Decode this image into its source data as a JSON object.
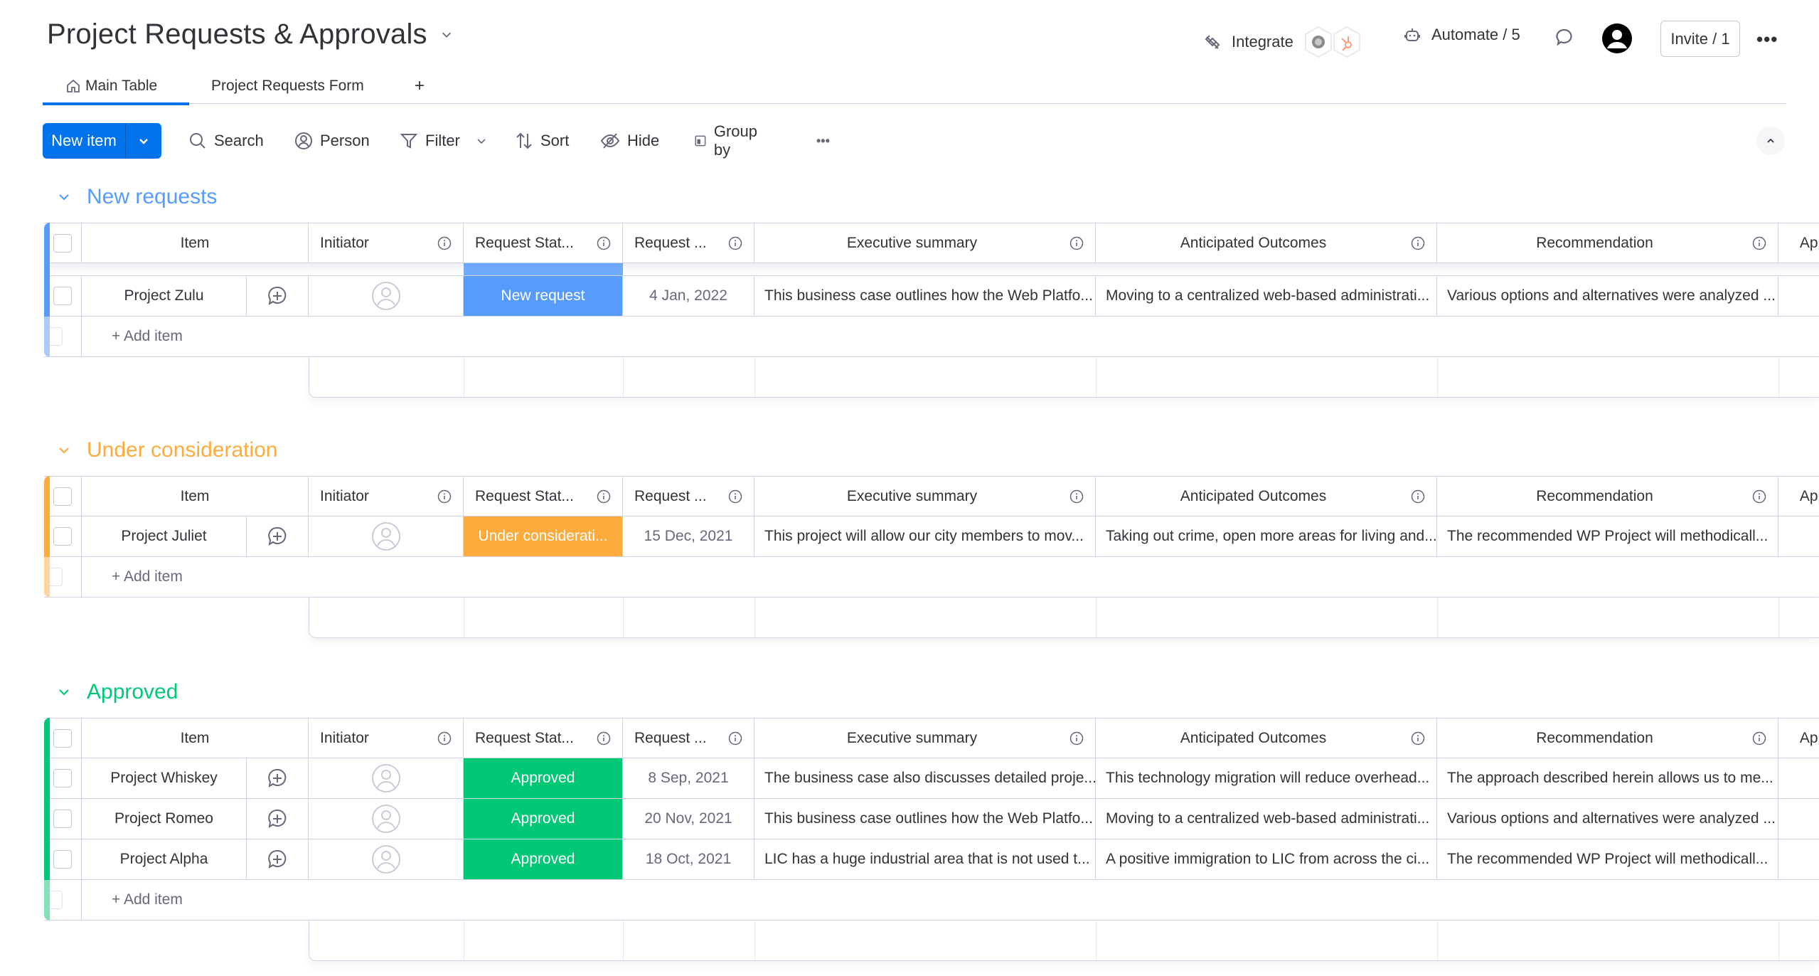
{
  "header": {
    "title": "Project Requests & Approvals",
    "integrate_label": "Integrate",
    "automate_label": "Automate / 5",
    "invite_label": "Invite / 1",
    "more_label": "•••"
  },
  "tabs": [
    {
      "label": "Main Table",
      "active": true
    },
    {
      "label": "Project Requests Form",
      "active": false
    },
    {
      "label": "+",
      "active": false
    }
  ],
  "toolbar": {
    "new_item_label": "New item",
    "search_label": "Search",
    "person_label": "Person",
    "filter_label": "Filter",
    "sort_label": "Sort",
    "hide_label": "Hide",
    "group_by_label": "Group by",
    "more_label": "•••"
  },
  "columns": {
    "item": "Item",
    "initiator": "Initiator",
    "status": "Request Stat...",
    "date": "Request ...",
    "exec": "Executive summary",
    "outcomes": "Anticipated Outcomes",
    "recommendation": "Recommendation",
    "app": "App"
  },
  "colors": {
    "new_requests": "#579bfc",
    "under_consideration": "#fdab3d",
    "approved": "#00c875",
    "accent": "#0073ea"
  },
  "groups": [
    {
      "title": "New requests",
      "add_item_label": "+ Add item",
      "rows": [
        {
          "item": "Project Zulu",
          "status": "New request",
          "date": "4 Jan, 2022",
          "exec": "This business case outlines how the Web Platfo...",
          "outcomes": "Moving to a centralized web-based administrati...",
          "recommendation": "Various options and alternatives were analyzed ..."
        }
      ]
    },
    {
      "title": "Under consideration",
      "add_item_label": "+ Add item",
      "rows": [
        {
          "item": "Project Juliet",
          "status": "Under considerati...",
          "date": "15 Dec, 2021",
          "exec": "This project will allow our city members to mov...",
          "outcomes": "Taking out crime, open more areas for living and...",
          "recommendation": "The recommended WP Project will methodicall..."
        }
      ]
    },
    {
      "title": "Approved",
      "add_item_label": "+ Add item",
      "rows": [
        {
          "item": "Project Whiskey",
          "status": "Approved",
          "date": "8 Sep, 2021",
          "exec": "The business case also discusses detailed proje...",
          "outcomes": "This technology migration will reduce overhead...",
          "recommendation": "The approach described herein allows us to me..."
        },
        {
          "item": "Project Romeo",
          "status": "Approved",
          "date": "20 Nov, 2021",
          "exec": "This business case outlines how the Web Platfo...",
          "outcomes": "Moving to a centralized web-based administrati...",
          "recommendation": "Various options and alternatives were analyzed ..."
        },
        {
          "item": "Project Alpha",
          "status": "Approved",
          "date": "18 Oct, 2021",
          "exec": "LIC has a huge industrial area that is not used t...",
          "outcomes": "A positive immigration to LIC from across the ci...",
          "recommendation": "The recommended WP Project will methodicall..."
        }
      ]
    }
  ]
}
